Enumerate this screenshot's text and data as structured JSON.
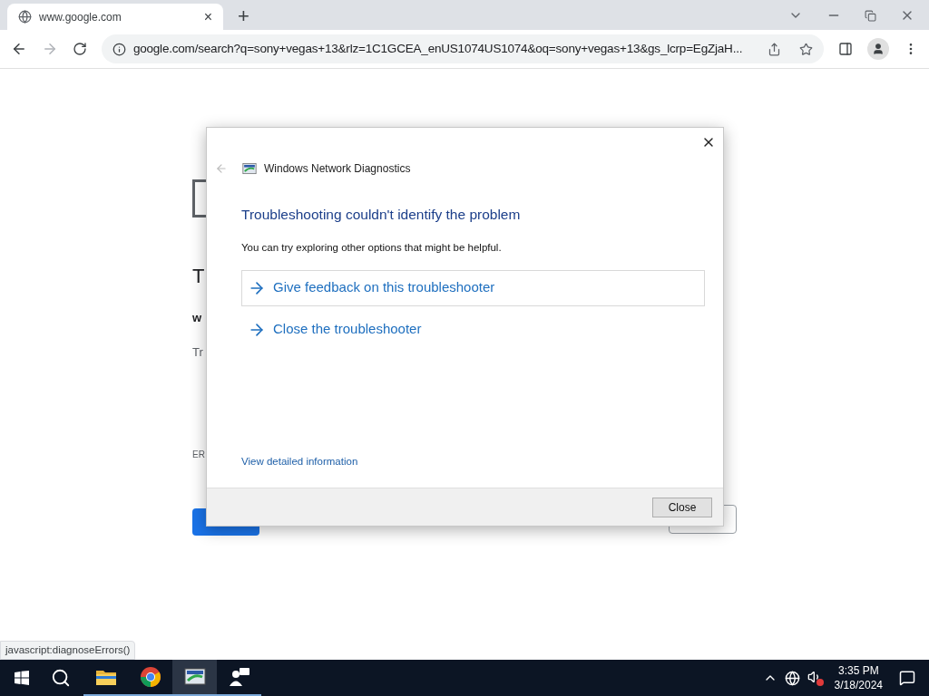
{
  "browser": {
    "tab": {
      "title": "www.google.com",
      "close": "×"
    },
    "new_tab": "+",
    "address": "google.com/search?q=sony+vegas+13&rlz=1C1GCEA_enUS1074US1074&oq=sony+vegas+13&gs_lcrp=EgZjaH...",
    "status": "javascript:diagnoseErrors()"
  },
  "page": {
    "heading": "T",
    "host": "w",
    "hint": "Tr",
    "code": "ER"
  },
  "dialog": {
    "title": "Windows Network Diagnostics",
    "heading": "Troubleshooting couldn't identify the problem",
    "message": "You can try exploring other options that might be helpful.",
    "options": [
      {
        "label": "Give feedback on this troubleshooter",
        "selected": true
      },
      {
        "label": "Close the troubleshooter",
        "selected": false
      }
    ],
    "details_link": "View detailed information",
    "close_button": "Close"
  },
  "taskbar": {
    "apps": [
      {
        "kind": "folder",
        "running": true,
        "active": false
      },
      {
        "kind": "chrome",
        "running": true,
        "active": false
      },
      {
        "kind": "diagnostics",
        "running": true,
        "active": true
      },
      {
        "kind": "people",
        "running": true,
        "active": false
      }
    ],
    "time": "3:35 PM",
    "date": "3/18/2024"
  }
}
